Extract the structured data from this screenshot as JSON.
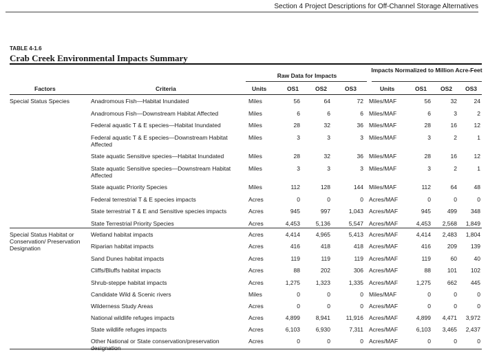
{
  "page": {
    "running_head": "Section 4 Project Descriptions for Off-Channel Storage Alternatives",
    "table_label": "TABLE 4-1.6",
    "table_title": "Crab Creek Environmental Impacts Summary"
  },
  "headers": {
    "group_raw": "Raw Data for Impacts",
    "group_norm": "Impacts Normalized to Million Acre-Feet",
    "factors": "Factors",
    "criteria": "Criteria",
    "units": "Units",
    "os1": "OS1",
    "os2": "OS2",
    "os3": "OS3",
    "norm_units": "Units",
    "n_os1": "OS1",
    "n_os2": "OS2",
    "n_os3": "OS3"
  },
  "sections": [
    {
      "factor": "Special Status Species",
      "rows": [
        {
          "criteria": "Anadromous Fish—Habitat Inundated",
          "units": "Miles",
          "os1": "56",
          "os2": "64",
          "os3": "72",
          "norm_units": "Miles/MAF",
          "n1": "56",
          "n2": "32",
          "n3": "24"
        },
        {
          "criteria": "Anadromous Fish—Downstream Habitat Affected",
          "units": "Miles",
          "os1": "6",
          "os2": "6",
          "os3": "6",
          "norm_units": "Miles/MAF",
          "n1": "6",
          "n2": "3",
          "n3": "2"
        },
        {
          "criteria": "Federal aquatic T & E species—Habitat Inundated",
          "units": "Miles",
          "os1": "28",
          "os2": "32",
          "os3": "36",
          "norm_units": "Miles/MAF",
          "n1": "28",
          "n2": "16",
          "n3": "12"
        },
        {
          "criteria": "Federal aquatic T & E species—Downstream Habitat Affected",
          "units": "Miles",
          "os1": "3",
          "os2": "3",
          "os3": "3",
          "norm_units": "Miles/MAF",
          "n1": "3",
          "n2": "2",
          "n3": "1"
        },
        {
          "criteria": "State aquatic Sensitive species—Habitat Inundated",
          "units": "Miles",
          "os1": "28",
          "os2": "32",
          "os3": "36",
          "norm_units": "Miles/MAF",
          "n1": "28",
          "n2": "16",
          "n3": "12"
        },
        {
          "criteria": "State aquatic Sensitive species—Downstream Habitat Affected",
          "units": "Miles",
          "os1": "3",
          "os2": "3",
          "os3": "3",
          "norm_units": "Miles/MAF",
          "n1": "3",
          "n2": "2",
          "n3": "1"
        },
        {
          "criteria": "State aquatic Priority Species",
          "units": "Miles",
          "os1": "112",
          "os2": "128",
          "os3": "144",
          "norm_units": "Miles/MAF",
          "n1": "112",
          "n2": "64",
          "n3": "48"
        },
        {
          "criteria": "Federal terrestrial T & E species impacts",
          "units": "Acres",
          "os1": "0",
          "os2": "0",
          "os3": "0",
          "norm_units": "Acres/MAF",
          "n1": "0",
          "n2": "0",
          "n3": "0"
        },
        {
          "criteria": "State terrestrial T & E and Sensitive species impacts",
          "units": "Acres",
          "os1": "945",
          "os2": "997",
          "os3": "1,043",
          "norm_units": "Acres/MAF",
          "n1": "945",
          "n2": "499",
          "n3": "348"
        },
        {
          "criteria": "State Terrestrial Priority Species",
          "units": "Acres",
          "os1": "4,453",
          "os2": "5,136",
          "os3": "5,547",
          "norm_units": "Acres/MAF",
          "n1": "4,453",
          "n2": "2,568",
          "n3": "1,849"
        }
      ]
    },
    {
      "factor": "Special Status Habitat or Conservation/ Preservation Designation",
      "rows": [
        {
          "criteria": "Wetland habitat impacts",
          "units": "Acres",
          "os1": "4,414",
          "os2": "4,965",
          "os3": "5,413",
          "norm_units": "Acres/MAF",
          "n1": "4,414",
          "n2": "2,483",
          "n3": "1,804"
        },
        {
          "criteria": "Riparian habitat impacts",
          "units": "Acres",
          "os1": "416",
          "os2": "418",
          "os3": "418",
          "norm_units": "Acres/MAF",
          "n1": "416",
          "n2": "209",
          "n3": "139"
        },
        {
          "criteria": "Sand Dunes habitat impacts",
          "units": "Acres",
          "os1": "119",
          "os2": "119",
          "os3": "119",
          "norm_units": "Acres/MAF",
          "n1": "119",
          "n2": "60",
          "n3": "40"
        },
        {
          "criteria": "Cliffs/Bluffs habitat impacts",
          "units": "Acres",
          "os1": "88",
          "os2": "202",
          "os3": "306",
          "norm_units": "Acres/MAF",
          "n1": "88",
          "n2": "101",
          "n3": "102"
        },
        {
          "criteria": "Shrub-steppe habitat impacts",
          "units": "Acres",
          "os1": "1,275",
          "os2": "1,323",
          "os3": "1,335",
          "norm_units": "Acres/MAF",
          "n1": "1,275",
          "n2": "662",
          "n3": "445"
        },
        {
          "criteria": "Candidate Wild & Scenic rivers",
          "units": "Miles",
          "os1": "0",
          "os2": "0",
          "os3": "0",
          "norm_units": "Miles/MAF",
          "n1": "0",
          "n2": "0",
          "n3": "0"
        },
        {
          "criteria": "Wilderness Study Areas",
          "units": "Acres",
          "os1": "0",
          "os2": "0",
          "os3": "0",
          "norm_units": "Acres/MAF",
          "n1": "0",
          "n2": "0",
          "n3": "0"
        },
        {
          "criteria": "National wildlife refuges impacts",
          "units": "Acres",
          "os1": "4,899",
          "os2": "8,941",
          "os3": "11,916",
          "norm_units": "Acres/MAF",
          "n1": "4,899",
          "n2": "4,471",
          "n3": "3,972"
        },
        {
          "criteria": "State wildlife refuges impacts",
          "units": "Acres",
          "os1": "6,103",
          "os2": "6,930",
          "os3": "7,311",
          "norm_units": "Acres/MAF",
          "n1": "6,103",
          "n2": "3,465",
          "n3": "2,437"
        },
        {
          "criteria": "Other National or State conservation/preservation designation",
          "units": "Acres",
          "os1": "0",
          "os2": "0",
          "os3": "0",
          "norm_units": "Acres/MAF",
          "n1": "0",
          "n2": "0",
          "n3": "0"
        }
      ]
    }
  ]
}
